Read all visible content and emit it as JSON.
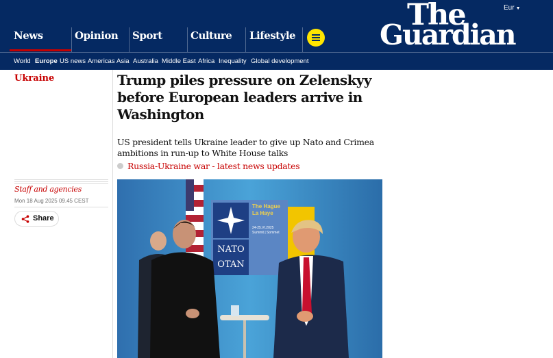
{
  "masthead": {
    "edition_label": "Eur",
    "logo_line1": "The",
    "logo_line2": "Guardian",
    "pillars": [
      {
        "label": "News",
        "active": true
      },
      {
        "label": "Opinion"
      },
      {
        "label": "Sport"
      },
      {
        "label": "Culture"
      },
      {
        "label": "Lifestyle"
      }
    ],
    "menu_icon": "hamburger-icon"
  },
  "subnav": {
    "items": [
      "World",
      "Europe",
      "US news",
      "Americas",
      "Asia",
      "Australia",
      "Middle East",
      "Africa",
      "Inequality",
      "Global development"
    ],
    "active": "Europe"
  },
  "article": {
    "section": "Ukraine",
    "headline_lines": [
      "Trump piles pressure on Zelenskyy",
      "before European leaders arrive in",
      "Washington"
    ],
    "standfirst_lines": [
      "US president tells Ukraine leader to give up Nato and Crimea",
      "ambitions in run-up to White House talks"
    ],
    "live_link": "Russia-Ukraine war - latest news updates",
    "byline": "Staff and agencies",
    "dateline": "Mon 18 Aug 2025 09.45 CEST",
    "share_label": "Share",
    "share_icon": "share-icon",
    "photo": {
      "sign_text": [
        "NATO",
        "OTAN"
      ],
      "summit_text": [
        "The Hague",
        "La Haye",
        "24-25.VI.2025",
        "Summit | Sommet"
      ]
    }
  },
  "colors": {
    "brand_navy": "#052962",
    "news_red": "#c70000",
    "menu_yellow": "#ffe500",
    "rule_grey": "#dcdcdc"
  }
}
